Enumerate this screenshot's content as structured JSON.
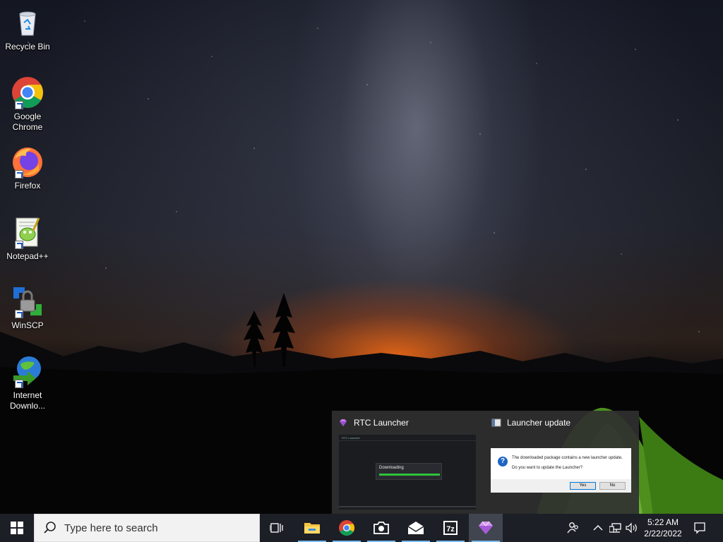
{
  "desktop": {
    "icons": [
      {
        "label": "Recycle Bin"
      },
      {
        "label": "Google Chrome"
      },
      {
        "label": "Firefox"
      },
      {
        "label": "Notepad++"
      },
      {
        "label": "WinSCP"
      },
      {
        "label": "Internet Downlo..."
      }
    ]
  },
  "thumbnails": {
    "rtc": {
      "title": "RTC Launcher",
      "app_name": "RTC Launcher",
      "download_text": "Downloading",
      "progress": 1.0
    },
    "update": {
      "title": "Launcher update",
      "message_line1": "The downloaded package contains a new launcher update.",
      "message_line2": "Do you want to update the Launcher?",
      "yes_label": "Yes",
      "no_label": "No"
    }
  },
  "taskbar": {
    "search_placeholder": "Type here to search",
    "apps": [
      {
        "name": "file-explorer-icon",
        "running": true
      },
      {
        "name": "chrome-icon",
        "running": true
      },
      {
        "name": "camera-icon",
        "running": true
      },
      {
        "name": "mail-icon",
        "running": true
      },
      {
        "name": "7zip-icon",
        "running": true
      },
      {
        "name": "rtc-launcher-icon",
        "running": true,
        "active": true
      }
    ],
    "clock": {
      "time": "5:22 AM",
      "date": "2/22/2022"
    }
  },
  "colors": {
    "taskbar_bg": "#1c1f26",
    "accent": "#76b9ed",
    "progress_green": "#2ec23a"
  }
}
